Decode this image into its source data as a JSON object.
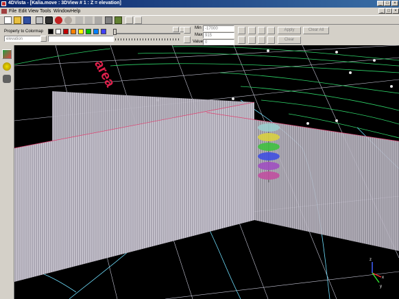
{
  "window": {
    "title": "4DVista - [Kalia.move : 3DView # 1 : Z = elevation]",
    "minimize_glyph": "_",
    "maximize_glyph": "□",
    "close_glyph": "×"
  },
  "menu": [
    "File",
    "Edit",
    "View",
    "Tools",
    "Window",
    "Help"
  ],
  "toolbar": {
    "icons": [
      "new-file-icon",
      "open-folder-icon",
      "save-icon",
      "print-icon",
      "camera-icon",
      "paint-icon",
      "undo-icon",
      "move-icon",
      "pointer-icon",
      "rotate-icon",
      "grid-icon",
      "flag-icon",
      "zoom-in-icon",
      "zoom-out-icon"
    ]
  },
  "colormap": {
    "label": "Property to Colormap",
    "selected": "elevation",
    "swatch_colors": [
      "#000000",
      "#ffffff",
      "#c00000",
      "#ff8000",
      "#ffff00",
      "#00c000",
      "#0080ff",
      "#4040ff"
    ]
  },
  "range": {
    "min_label": "Min",
    "min_value": "-17000",
    "max_label": "Max",
    "max_value": "915",
    "value_label": "Value",
    "value_value": "0"
  },
  "buttons": {
    "apply": "Apply",
    "clear_all": "Clear All",
    "clear": "Clear"
  },
  "viewport": {
    "annotation_text": "area",
    "axes": {
      "x": "x",
      "y": "y",
      "z": "z"
    },
    "colors": {
      "seismic": "#b8b4c0",
      "contour": "#2fd66a",
      "well": "#6fe0ff",
      "label": "#e0204c"
    }
  }
}
